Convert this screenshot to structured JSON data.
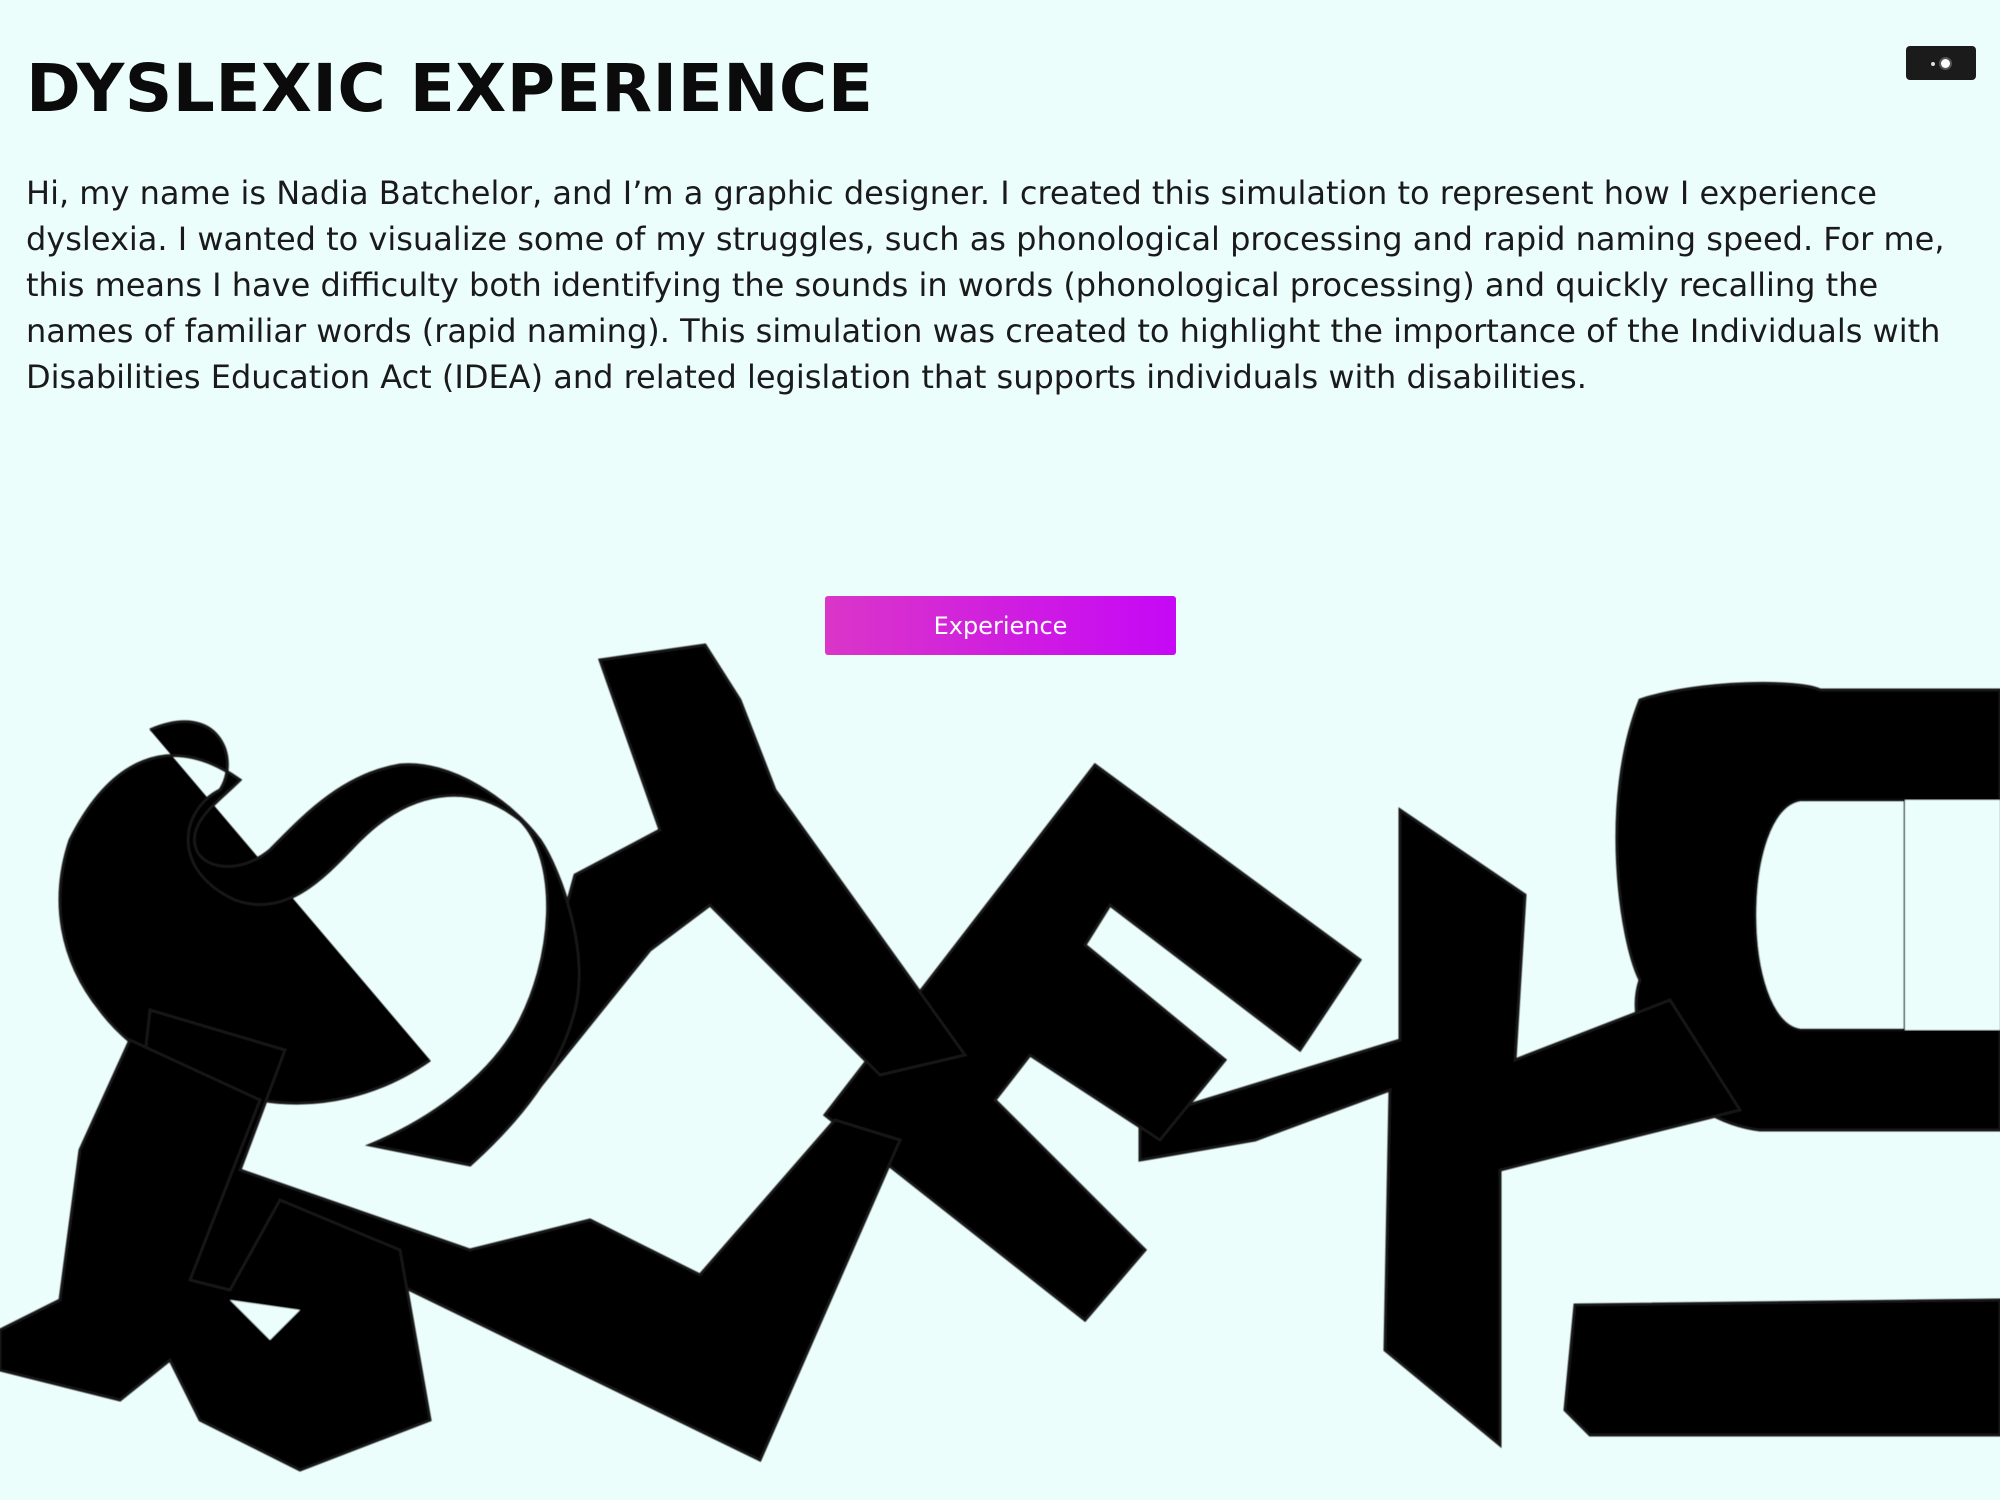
{
  "header": {
    "title": "DYSLEXIC EXPERIENCE"
  },
  "intro": {
    "text": "Hi, my name is Nadia Batchelor, and I’m a graphic designer. I created this simulation to represent how I experience dyslexia. I wanted to visualize some of my struggles, such as phonological processing and rapid naming speed. For me, this means I have difficulty both identifying the sounds in words (phonological processing) and quickly recalling the names of familiar words (rapid naming). This simulation was created to highlight the importance of the Individuals with Disabilities Education Act (IDEA) and related legislation that supports individuals with disabilities."
  },
  "toggle": {
    "icon": "dots-toggle-icon"
  },
  "cta": {
    "label": "Experience"
  },
  "artwork": {
    "letters": [
      "D",
      "Y",
      "S",
      "L",
      "E",
      "X",
      "I",
      "C"
    ],
    "color": "#000000"
  },
  "colors": {
    "background": "#ecfefc",
    "button_start": "#da36c8",
    "button_end": "#c608f6"
  }
}
